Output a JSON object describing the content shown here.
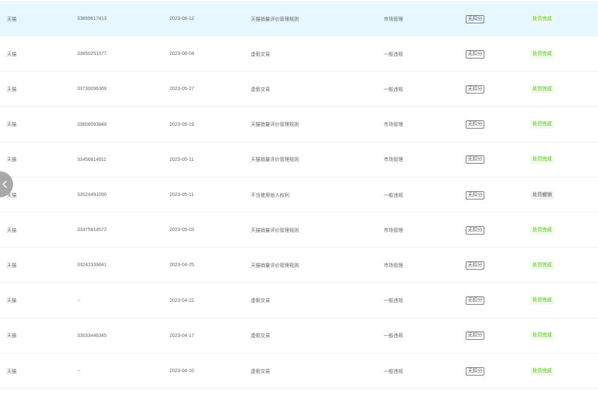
{
  "rows": [
    {
      "platform": "天猫",
      "id": "33899617413",
      "date": "2023-08-12",
      "reason": "天猫销量评价管理规则",
      "type": "市场管理",
      "deduction": "无扣分",
      "status": "处罚完成",
      "status_kind": "done",
      "highlight": true
    },
    {
      "platform": "天猫",
      "id": "33850251577",
      "date": "2023-08-04",
      "reason": "虚假交易",
      "type": "一般违规",
      "deduction": "无扣分",
      "status": "处罚完成",
      "status_kind": "done"
    },
    {
      "platform": "天猫",
      "id": "33730096369",
      "date": "2023-05-27",
      "reason": "虚假交易",
      "type": "一般违规",
      "deduction": "无扣分",
      "status": "处罚完成",
      "status_kind": "done"
    },
    {
      "platform": "天猫",
      "id": "33608093848",
      "date": "2023-05-19",
      "reason": "天猫销量评价管理规则",
      "type": "市场管理",
      "deduction": "无扣分",
      "status": "处罚完成",
      "status_kind": "done"
    },
    {
      "platform": "天猫",
      "id": "33456814911",
      "date": "2023-05-11",
      "reason": "天猫销量评价管理规则",
      "type": "市场管理",
      "deduction": "无扣分",
      "status": "处罚完成",
      "status_kind": "done"
    },
    {
      "platform": "天猫",
      "id": "33524491090",
      "date": "2023-05-11",
      "reason": "不当使用他人权利",
      "type": "一般违规",
      "deduction": "无扣分",
      "status": "处罚撤销",
      "status_kind": "revoked"
    },
    {
      "platform": "天猫",
      "id": "33375614572",
      "date": "2023-05-03",
      "reason": "天猫销量评价管理规则",
      "type": "市场管理",
      "deduction": "无扣分",
      "status": "处罚完成",
      "status_kind": "done"
    },
    {
      "platform": "天猫",
      "id": "33242339841",
      "date": "2023-04-25",
      "reason": "天猫销量评价管理规则",
      "type": "市场管理",
      "deduction": "无扣分",
      "status": "处罚完成",
      "status_kind": "done"
    },
    {
      "platform": "天猫",
      "id": "--",
      "date": "2023-04-22",
      "reason": "虚假交易",
      "type": "一般违规",
      "deduction": "无扣分",
      "status": "处罚完成",
      "status_kind": "done"
    },
    {
      "platform": "天猫",
      "id": "33033446345",
      "date": "2023-04-17",
      "reason": "虚假交易",
      "type": "一般违规",
      "deduction": "无扣分",
      "status": "处罚完成",
      "status_kind": "done"
    },
    {
      "platform": "天猫",
      "id": "--",
      "date": "2023-04-10",
      "reason": "虚假交易",
      "type": "一般违规",
      "deduction": "无扣分",
      "status": "处罚完成",
      "status_kind": "done"
    }
  ],
  "icons": {
    "back": "chevron-left-icon"
  },
  "colors": {
    "highlight_row": "#e6f7ff",
    "status_done": "#52c41a",
    "status_done_bg": "#f0fbe8",
    "status_revoked_bg": "#f2f2f2"
  }
}
